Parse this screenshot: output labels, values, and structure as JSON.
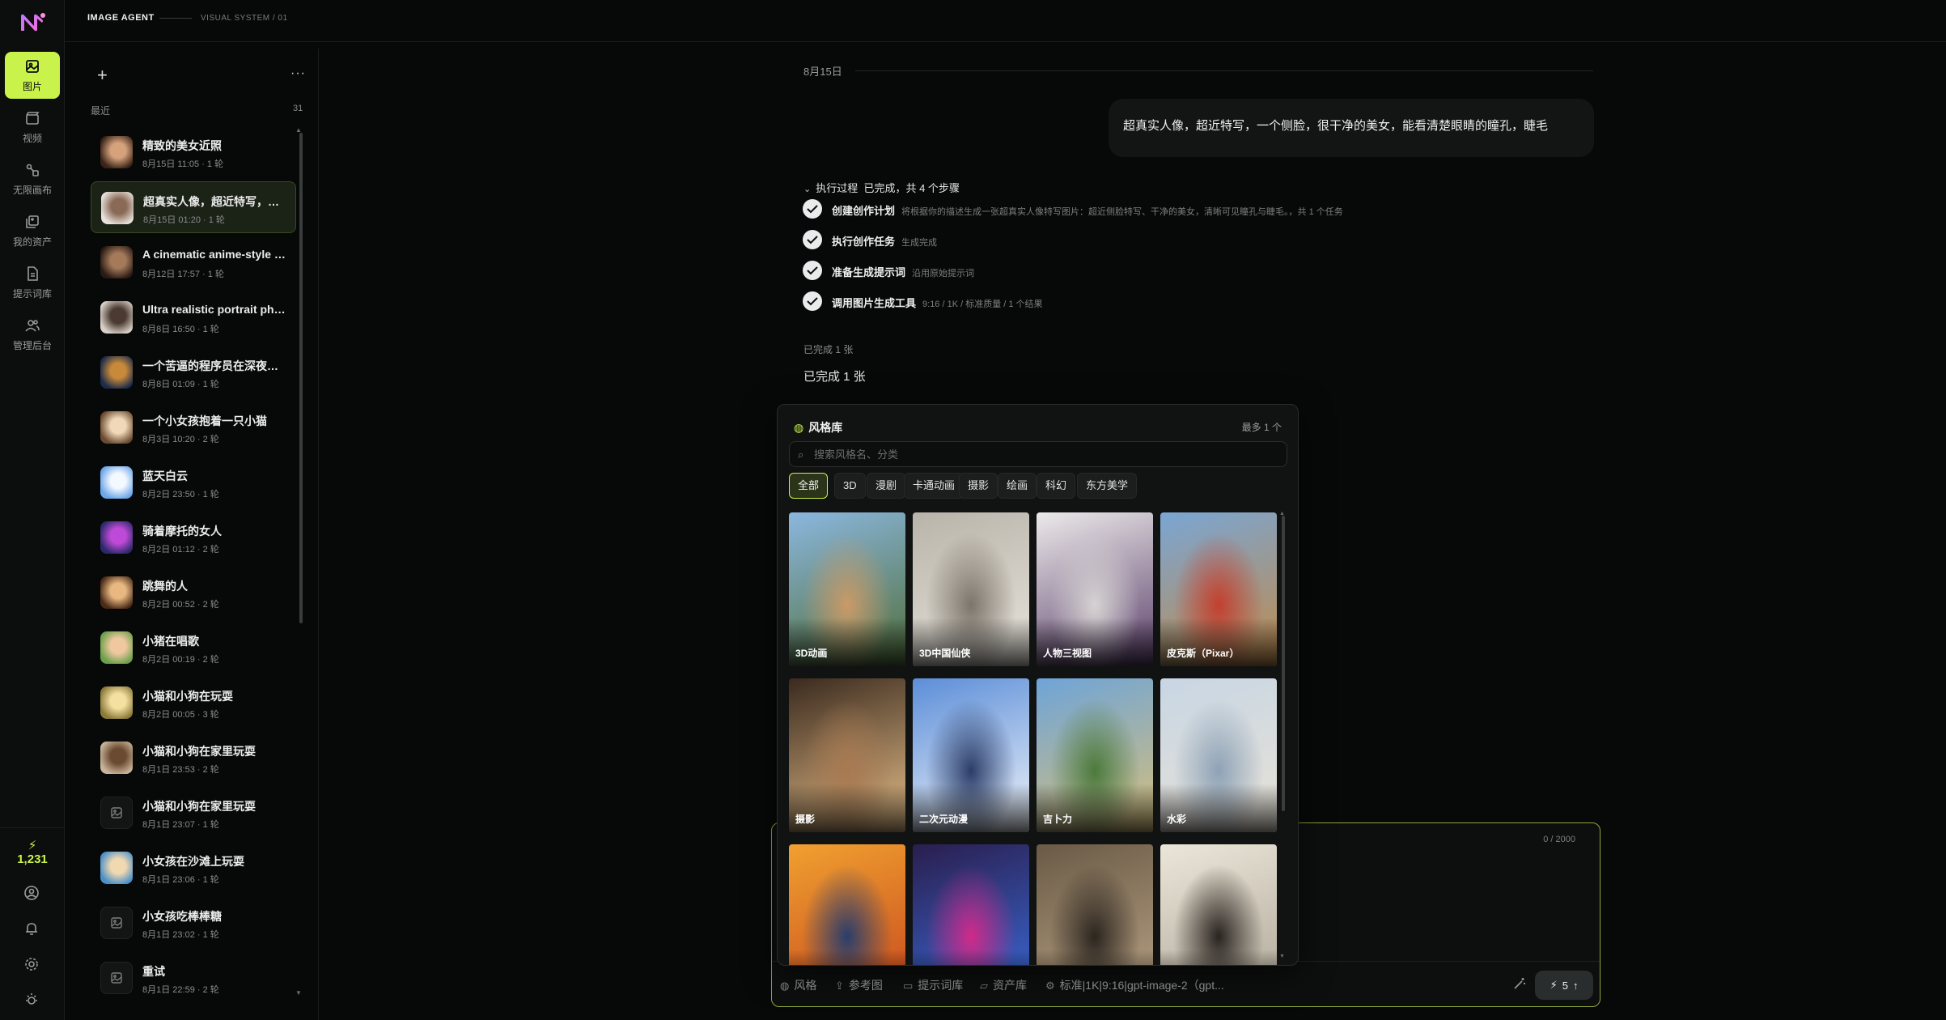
{
  "app": {
    "brand": "IMAGE AGENT",
    "subtitle": "VISUAL SYSTEM / 01",
    "accent_color": "#c9f24a"
  },
  "rail": {
    "items": [
      {
        "label": "图片",
        "icon": "image-icon",
        "active": true
      },
      {
        "label": "视频",
        "icon": "video-icon",
        "active": false
      },
      {
        "label": "无限画布",
        "icon": "canvas-icon",
        "active": false
      },
      {
        "label": "我的资产",
        "icon": "assets-icon",
        "active": false
      },
      {
        "label": "提示词库",
        "icon": "prompt-library-icon",
        "active": false
      },
      {
        "label": "管理后台",
        "icon": "admin-icon",
        "active": false
      }
    ],
    "credits": "1,231",
    "bottom_icons": [
      "user-icon",
      "bell-icon",
      "settings-icon",
      "theme-icon"
    ]
  },
  "sessions": {
    "recent_label": "最近",
    "count": "31",
    "items": [
      {
        "title": "精致的美女近照",
        "meta": "8月15日 11:05 · 1 轮",
        "active": false
      },
      {
        "title": "超真实人像，超近特写，一个侧脸",
        "meta": "8月15日 01:20 · 1 轮",
        "active": true
      },
      {
        "title": "A cinematic anime-style render",
        "meta": "8月12日 17:57 · 1 轮",
        "active": false
      },
      {
        "title": "Ultra realistic portrait photo",
        "meta": "8月8日 16:50 · 1 轮",
        "active": false
      },
      {
        "title": "一个苦逼的程序员在深夜加班",
        "meta": "8月8日 01:09 · 1 轮",
        "active": false
      },
      {
        "title": "一个小女孩抱着一只小猫",
        "meta": "8月3日 10:20 · 2 轮",
        "active": false
      },
      {
        "title": "蓝天白云",
        "meta": "8月2日 23:50 · 1 轮",
        "active": false
      },
      {
        "title": "骑着摩托的女人",
        "meta": "8月2日 01:12 · 2 轮",
        "active": false
      },
      {
        "title": "跳舞的人",
        "meta": "8月2日 00:52 · 2 轮",
        "active": false
      },
      {
        "title": "小猪在唱歌",
        "meta": "8月2日 00:19 · 2 轮",
        "active": false
      },
      {
        "title": "小猫和小狗在玩耍",
        "meta": "8月2日 00:05 · 3 轮",
        "active": false
      },
      {
        "title": "小猫和小狗在家里玩耍",
        "meta": "8月1日 23:53 · 2 轮",
        "active": false
      },
      {
        "title": "小猫和小狗在家里玩耍",
        "meta": "8月1日 23:07 · 1 轮",
        "active": false
      },
      {
        "title": "小女孩在沙滩上玩耍",
        "meta": "8月1日 23:06 · 1 轮",
        "active": false
      },
      {
        "title": "小女孩吃棒棒糖",
        "meta": "8月1日 23:02 · 1 轮",
        "active": false
      },
      {
        "title": "重试",
        "meta": "8月1日 22:59 · 2 轮",
        "active": false
      }
    ]
  },
  "chat": {
    "date": "8月15日",
    "user_message": "超真实人像，超近特写，一个侧脸，很干净的美女，能看清楚眼睛的瞳孔，睫毛",
    "process_title": "执行过程",
    "process_status": "已完成，共 4 个步骤",
    "steps": [
      {
        "name": "创建创作计划",
        "desc": "将根据你的描述生成一张超真实人像特写图片：超近侧脸特写、干净的美女，清晰可见瞳孔与睫毛。，共 1 个任务"
      },
      {
        "name": "执行创作任务",
        "desc": "生成完成"
      },
      {
        "name": "准备生成提示词",
        "desc": "沿用原始提示词"
      },
      {
        "name": "调用图片生成工具",
        "desc": "9:16 / 1K / 标准质量 / 1 个结果"
      }
    ],
    "done_small": "已完成 1 张",
    "done_big": "已完成 1 张"
  },
  "style_library": {
    "title": "风格库",
    "limit": "最多 1 个",
    "search_placeholder": "搜索风格名、分类",
    "chips": [
      {
        "label": "全部",
        "active": true
      },
      {
        "label": "3D",
        "active": false
      },
      {
        "label": "漫剧",
        "active": false
      },
      {
        "label": "卡通动画",
        "active": false
      },
      {
        "label": "摄影",
        "active": false
      },
      {
        "label": "绘画",
        "active": false
      },
      {
        "label": "科幻",
        "active": false
      },
      {
        "label": "东方美学",
        "active": false
      }
    ],
    "cards": [
      {
        "label": "3D动画",
        "colors": [
          "#8bb7de",
          "#c99a68",
          "#4f6d38"
        ]
      },
      {
        "label": "3D中国仙侠",
        "colors": [
          "#b9b4aa",
          "#7d756c",
          "#e8e4dc"
        ]
      },
      {
        "label": "人物三视图",
        "colors": [
          "#eceaea",
          "#d6d3d3",
          "#5a3e6a"
        ]
      },
      {
        "label": "皮克斯（Pixar）",
        "colors": [
          "#7aa6d4",
          "#c2402f",
          "#c08a4a"
        ]
      },
      {
        "label": "摄影",
        "colors": [
          "#3a2a1e",
          "#a87a52",
          "#e8c08a"
        ]
      },
      {
        "label": "二次元动漫",
        "colors": [
          "#5c8ed8",
          "#2c3e68",
          "#f0f4fa"
        ]
      },
      {
        "label": "吉卜力",
        "colors": [
          "#6ea4d8",
          "#4c7a3c",
          "#d8c07a"
        ]
      },
      {
        "label": "水彩",
        "colors": [
          "#c8d6e4",
          "#8ea2b6",
          "#e8e2d6"
        ]
      },
      {
        "label": "",
        "colors": [
          "#f0a030",
          "#2a3e6a",
          "#c84a1e"
        ]
      },
      {
        "label": "",
        "colors": [
          "#2a1e4e",
          "#d02a8a",
          "#3a6ad8"
        ]
      },
      {
        "label": "",
        "colors": [
          "#6a5a46",
          "#2c2620",
          "#b8a284"
        ]
      },
      {
        "label": "",
        "colors": [
          "#ece6da",
          "#2a2420",
          "#b0a898"
        ]
      }
    ]
  },
  "composer": {
    "counter": "0 / 2000",
    "tools": [
      "风格",
      "参考图",
      "提示词库",
      "资产库",
      "标准|1K|9:16|gpt-image-2（gpt..."
    ],
    "send_cost": "5"
  }
}
